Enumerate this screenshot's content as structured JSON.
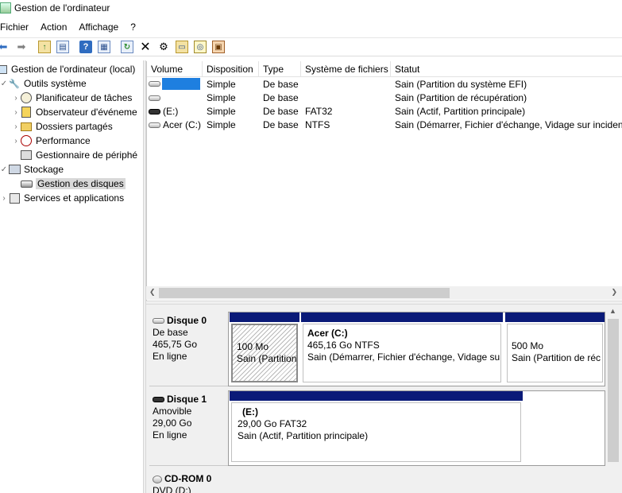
{
  "window": {
    "title": "Gestion de l'ordinateur"
  },
  "menu": [
    "Fichier",
    "Action",
    "Affichage",
    "?"
  ],
  "toolbar_icons": [
    "back-arrow-icon",
    "forward-arrow-icon",
    "up-folder-icon",
    "show-hide-tree-icon",
    "help-icon",
    "properties-icon",
    "refresh-icon",
    "delete-icon",
    "settings-icon",
    "open-folder-icon",
    "search-disk-icon",
    "export-icon"
  ],
  "tree": {
    "root": "Gestion de l'ordinateur (local)",
    "system_tools": "Outils système",
    "task_scheduler": "Planificateur de tâches",
    "event_viewer": "Observateur d'événeme",
    "shared_folders": "Dossiers partagés",
    "performance": "Performance",
    "device_manager": "Gestionnaire de périphé",
    "storage": "Stockage",
    "disk_management": "Gestion des disques",
    "services": "Services et applications"
  },
  "volumes": {
    "headers": [
      "Volume",
      "Disposition",
      "Type",
      "Système de fichiers",
      "Statut"
    ],
    "rows": [
      {
        "volume": "",
        "layout": "Simple",
        "type": "De base",
        "fs": "",
        "status": "Sain (Partition du système EFI)"
      },
      {
        "volume": "",
        "layout": "Simple",
        "type": "De base",
        "fs": "",
        "status": "Sain (Partition de récupération)"
      },
      {
        "volume": "(E:)",
        "layout": "Simple",
        "type": "De base",
        "fs": "FAT32",
        "status": "Sain (Actif, Partition principale)"
      },
      {
        "volume": "Acer (C:)",
        "layout": "Simple",
        "type": "De base",
        "fs": "NTFS",
        "status": "Sain (Démarrer, Fichier d'échange, Vidage sur incident"
      }
    ]
  },
  "disks": {
    "disk0": {
      "name": "Disque 0",
      "type": "De base",
      "size": "465,75 Go",
      "state": "En ligne",
      "parts": [
        {
          "title": "",
          "size": "100 Mo",
          "status": "Sain (Partition"
        },
        {
          "title": "Acer  (C:)",
          "size": "465,16 Go NTFS",
          "status": "Sain (Démarrer, Fichier d'échange, Vidage sur"
        },
        {
          "title": "",
          "size": "500 Mo",
          "status": "Sain (Partition de réc"
        }
      ]
    },
    "disk1": {
      "name": "Disque 1",
      "type": "Amovible",
      "size": "29,00 Go",
      "state": "En ligne",
      "part": {
        "title": "(E:)",
        "size": "29,00 Go FAT32",
        "status": "Sain (Actif, Partition principale)"
      }
    },
    "cdrom0": {
      "name": "CD-ROM 0",
      "type": "DVD (D:)"
    }
  }
}
